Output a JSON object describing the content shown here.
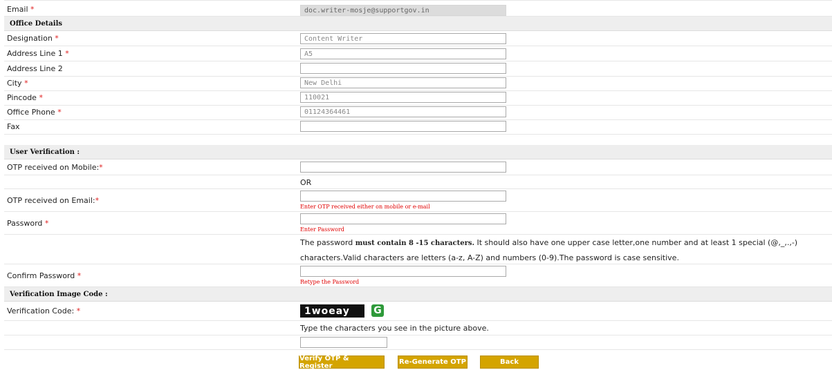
{
  "fields": {
    "email": {
      "label": "Email",
      "value": "doc.writer-mosje@supportgov.in"
    },
    "designation": {
      "label": "Designation",
      "value": "Content Writer"
    },
    "address1": {
      "label": "Address Line 1",
      "value": "A5"
    },
    "address2": {
      "label": "Address Line 2",
      "value": ""
    },
    "city": {
      "label": "City",
      "value": "New Delhi"
    },
    "pincode": {
      "label": "Pincode",
      "value": "110021"
    },
    "office_phone": {
      "label": "Office Phone",
      "value": "01124364461"
    },
    "fax": {
      "label": "Fax",
      "value": ""
    }
  },
  "sections": {
    "office": "Office Details",
    "user_verification": "User Verification :",
    "image_code": "Verification Image Code :"
  },
  "verification": {
    "otp_mobile_label": "OTP received on Mobile:",
    "or_text": "OR",
    "otp_email_label": "OTP received on Email:",
    "otp_hint": "Enter OTP received either on mobile or e-mail",
    "password_label": "Password",
    "password_hint": "Enter Password",
    "password_note_pre": "The password ",
    "password_note_bold": "must contain 8 -15 characters.",
    "password_note_post": " It should also have one upper case letter,one number and at least 1 special (@,_,.,-) characters.Valid characters are letters (a-z, A-Z) and numbers (0-9).The password is case sensitive.",
    "confirm_label": "Confirm Password",
    "confirm_hint": "Retype the Password"
  },
  "captcha": {
    "label": "Verification Code:",
    "image_text": "1woeay",
    "refresh_glyph": "G",
    "instruction": "Type the characters you see in the picture above.",
    "value": ""
  },
  "required_mark": "*",
  "buttons": {
    "verify": "Verify OTP & Register",
    "regenerate": "Re-Generate OTP",
    "back": "Back"
  },
  "colors": {
    "button_bg": "#d4a400",
    "required": "#e02020",
    "hint": "#e00000",
    "section_bg": "#eeeeee",
    "refresh_icon": "#2e9a3a"
  },
  "icons": {
    "captcha_refresh": "refresh-icon"
  }
}
